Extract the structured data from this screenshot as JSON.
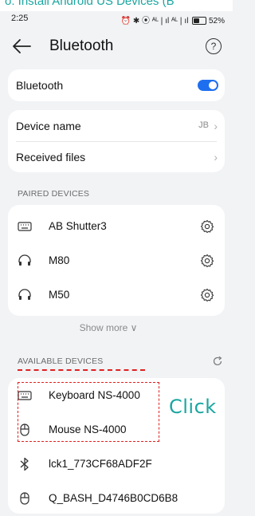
{
  "banner": {
    "text": "o: Install Android US Devices (B"
  },
  "status_bar": {
    "time": "2:25",
    "signal_text": "⏰ ✱ ⦿ ᴬᴸ❘ıl ᴬᴸ❘ıl",
    "battery": "52%"
  },
  "header": {
    "title": "Bluetooth"
  },
  "bluetooth_row": {
    "label": "Bluetooth",
    "enabled": true
  },
  "device_name_row": {
    "label": "Device name",
    "value": "JB"
  },
  "received_files_row": {
    "label": "Received files"
  },
  "paired_section": {
    "label": "PAIRED DEVICES"
  },
  "paired_devices": [
    {
      "name": "AB Shutter3",
      "icon": "keyboard-icon"
    },
    {
      "name": "M80",
      "icon": "headphones-icon"
    },
    {
      "name": "M50",
      "icon": "headphones-icon"
    }
  ],
  "show_more": {
    "label": "Show more ∨"
  },
  "available_section": {
    "label": "AVAILABLE DEVICES"
  },
  "available_devices": [
    {
      "name": "Keyboard NS-4000",
      "icon": "keyboard-icon"
    },
    {
      "name": "Mouse NS-4000",
      "icon": "mouse-icon"
    },
    {
      "name": "lck1_773CF68ADF2F",
      "icon": "bluetooth-icon"
    },
    {
      "name": "Q_BASH_D4746B0CD6B8",
      "icon": "mouse-icon"
    }
  ],
  "annotation": {
    "click_text": "Click"
  },
  "colors": {
    "accent": "#1e6ff0",
    "annotation": "#e02020",
    "teal": "#1aa6a0"
  }
}
